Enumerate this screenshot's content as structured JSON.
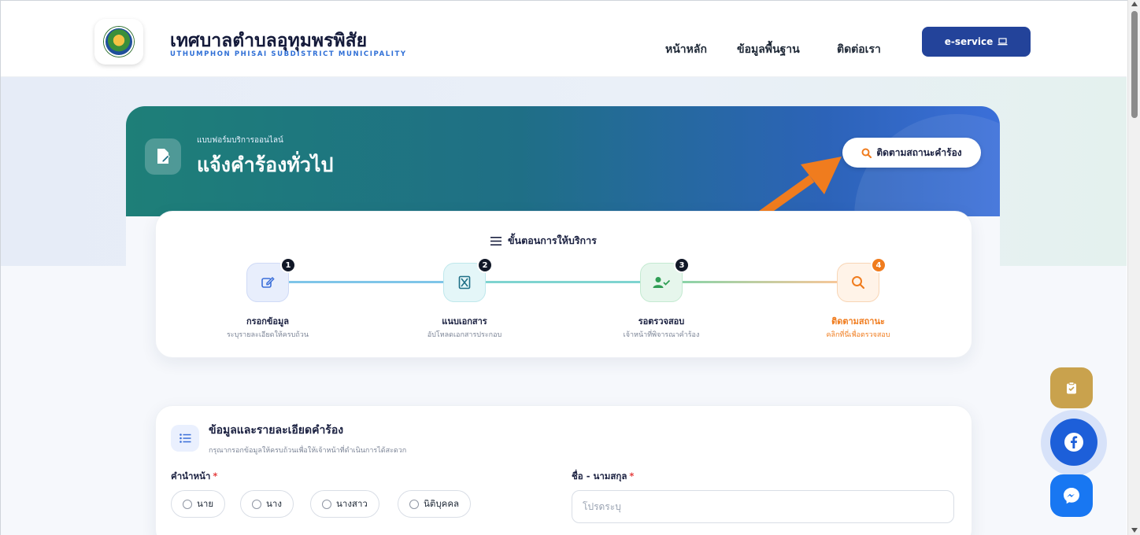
{
  "header": {
    "title": "เทศบาลตำบลอุทุมพรพิสัย",
    "subtitle": "UTHUMPHON PHISAI SUBDISTRICT MUNICIPALITY",
    "nav": [
      {
        "label": "หน้าหลัก"
      },
      {
        "label": "ข้อมูลพื้นฐาน"
      },
      {
        "label": "ติดต่อเรา"
      }
    ],
    "eservice_label": "e-service"
  },
  "hero": {
    "kicker": "แบบฟอร์มบริการออนไลน์",
    "title": "แจ้งคำร้องทั่วไป",
    "track_button": "ติดตามสถานะคำร้อง"
  },
  "steps": {
    "title": "ขั้นตอนการให้บริการ",
    "items": [
      {
        "num": "1",
        "label": "กรอกข้อมูล",
        "desc": "ระบุรายละเอียดให้ครบถ้วน",
        "icon": "edit-icon"
      },
      {
        "num": "2",
        "label": "แนบเอกสาร",
        "desc": "อัปโหลดเอกสารประกอบ",
        "icon": "hourglass-icon"
      },
      {
        "num": "3",
        "label": "รอตรวจสอบ",
        "desc": "เจ้าหน้าที่พิจารณาคำร้อง",
        "icon": "user-check-icon"
      },
      {
        "num": "4",
        "label": "ติดตามสถานะ",
        "desc": "คลิกที่นี่เพื่อตรวจสอบ",
        "icon": "search-icon"
      }
    ]
  },
  "form": {
    "title": "ข้อมูลและรายละเอียดคำร้อง",
    "subtitle": "กรุณากรอกข้อมูลให้ครบถ้วนเพื่อให้เจ้าหน้าที่ดำเนินการได้สะดวก",
    "prefix_label": "คำนำหน้า",
    "prefix_options": [
      "นาย",
      "นาง",
      "นางสาว",
      "นิติบุคคล"
    ],
    "name_label": "ชื่อ - นามสกุล",
    "name_placeholder": "โปรดระบุ",
    "required_mark": "*"
  },
  "colors": {
    "accent": "#23439a",
    "hero_start": "#1e7f78",
    "hero_end": "#3b6fd9",
    "step_active": "#f07c1e",
    "annotation_arrow": "#f07c1e"
  }
}
